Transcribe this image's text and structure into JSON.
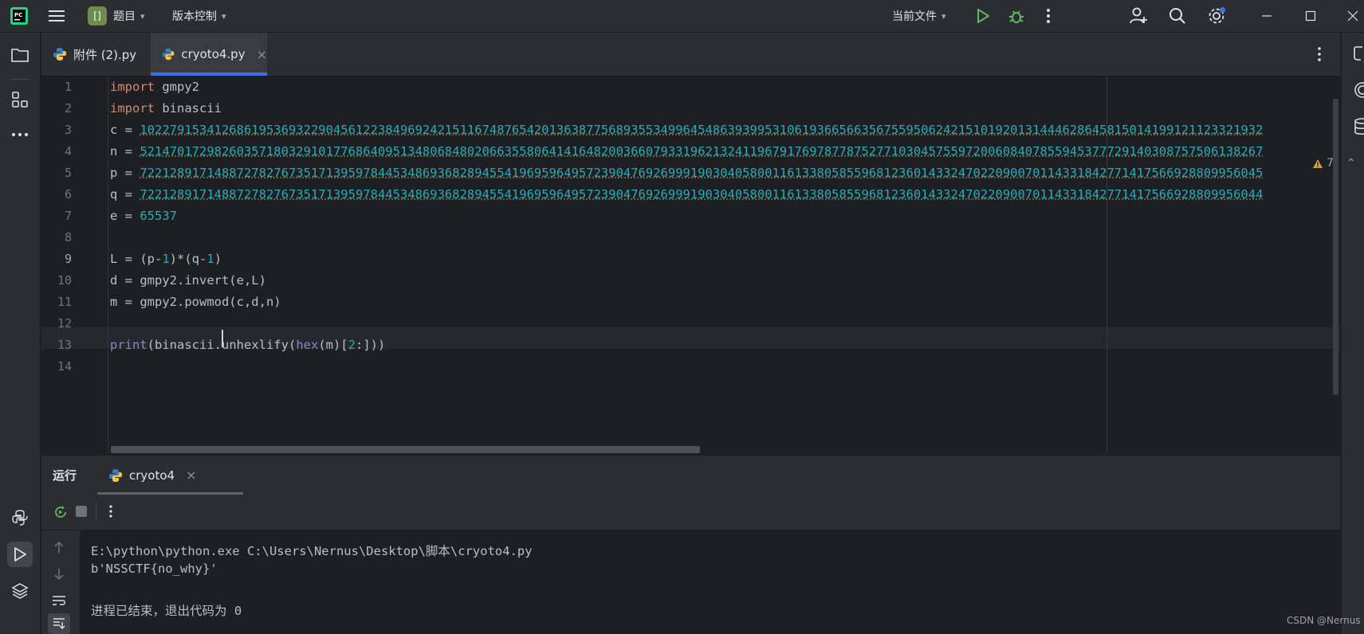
{
  "titlebar": {
    "project_badge": "[]",
    "project_label": "题目",
    "vcs_label": "版本控制",
    "run_config_label": "当前文件",
    "icons": [
      "pycharm-logo-icon",
      "main-menu-icon",
      "run-icon",
      "debug-icon",
      "more-icon",
      "add-user-icon",
      "search-icon",
      "settings-icon",
      "minimize-icon",
      "maximize-icon",
      "close-icon"
    ]
  },
  "editor_tabs": [
    {
      "label": "附件 (2).py",
      "active": false
    },
    {
      "label": "cryoto4.py",
      "active": true
    }
  ],
  "editor": {
    "inspection_count": "7",
    "current_line": 9,
    "line_numbers": [
      "1",
      "2",
      "3",
      "4",
      "5",
      "6",
      "7",
      "8",
      "9",
      "10",
      "11",
      "12",
      "13",
      "14"
    ],
    "lines": {
      "l1_kw": "import",
      "l1_rest": " gmpy2",
      "l2_kw": "import",
      "l2_rest": " binascii",
      "l3_prefix": "c = ",
      "l3_num": "1022791534126861953693229045612238496924215116748765420136387756893553499645486393995310619366566356755950624215101920131444628645815014199121123321932",
      "l4_prefix": "n = ",
      "l4_num": "5214701729826035718032910177686409513480684802066355806414164820036607933196213241196791769787787527710304575597200608407855945377729140308757506138267",
      "l5_prefix": "p = ",
      "l5_num": "7221289171488727827673517139597844534869368289455419695964957239047692699919030405800116133805855968123601433247022090070114331842771417566928809956045",
      "l6_prefix": "q = ",
      "l6_num": "7221289171488727827673517139597844534869368289455419695964957239047692699919030405800116133805855968123601433247022090070114331842771417566928809956044",
      "l7_prefix": "e = ",
      "l7_num": "65537",
      "l9_a": "L = (p-",
      "l9_n1": "1",
      "l9_b": ")*(q-",
      "l9_n2": "1",
      "l9_c": ")",
      "l10": "d = gmpy2.invert(e,L)",
      "l11": "m = gmpy2.powmod(c,d,n)",
      "l13_bi1": "print",
      "l13_a": "(binascii.unhexlify(",
      "l13_bi2": "hex",
      "l13_b": "(m)[",
      "l13_n": "2",
      "l13_c": ":]))"
    }
  },
  "run_panel": {
    "title": "运行",
    "tab_label": "cryoto4",
    "console": [
      "E:\\python\\python.exe C:\\Users\\Nernus\\Desktop\\脚本\\cryoto4.py",
      "b'NSSCTF{no_why}'",
      "",
      "进程已结束，退出代码为 0"
    ]
  },
  "watermark": "CSDN @Nernus",
  "colors": {
    "background": "#1e1f22",
    "panel": "#2b2d30",
    "keyword": "#cf8e6d",
    "number": "#2aacb8",
    "builtin": "#8888c6",
    "accent": "#3574f0",
    "run_green": "#5fb865"
  }
}
